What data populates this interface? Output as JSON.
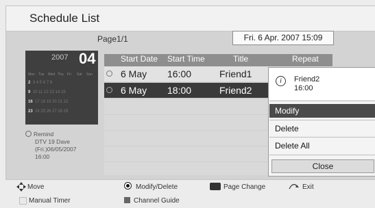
{
  "header": {
    "title": "Schedule List"
  },
  "info_bar": {
    "page": "Page1/1",
    "datetime": "Fri. 6 Apr. 2007 15:09"
  },
  "calendar": {
    "year": "2007",
    "month": "04",
    "weekdays": [
      "Mon",
      "Tue",
      "Wed",
      "Thu",
      "Fri",
      "Sat",
      "Sun"
    ],
    "weeks": [
      {
        "wk": "2",
        "days": "3 4 5 6 7 8"
      },
      {
        "wk": "9",
        "days": "10 11 12 13 14 15"
      },
      {
        "wk": "16",
        "days": "17 18 19 20 21 22"
      },
      {
        "wk": "23",
        "days": "24 25 26 27 28 29"
      }
    ]
  },
  "remind": {
    "label": "Remind",
    "line1": "DTV 19 Dave",
    "line2": "(Fri.)06/05/2007",
    "line3": "16:00"
  },
  "table": {
    "headers": [
      "Start Date",
      "Start Time",
      "Title",
      "Repeat"
    ],
    "rows": [
      {
        "date": "6 May",
        "time": "16:00",
        "title": "Friend1"
      },
      {
        "date": "6 May",
        "time": "18:00",
        "title": "Friend2"
      }
    ]
  },
  "popup": {
    "name": "Friend2",
    "time": "16:00",
    "items": [
      "Modify",
      "Delete",
      "Delete All"
    ],
    "close": "Close"
  },
  "legend": {
    "move": "Move",
    "modify_delete": "Modify/Delete",
    "page_change": "Page Change",
    "exit": "Exit",
    "manual_timer": "Manual Timer",
    "channel_guide": "Channel Guide"
  }
}
